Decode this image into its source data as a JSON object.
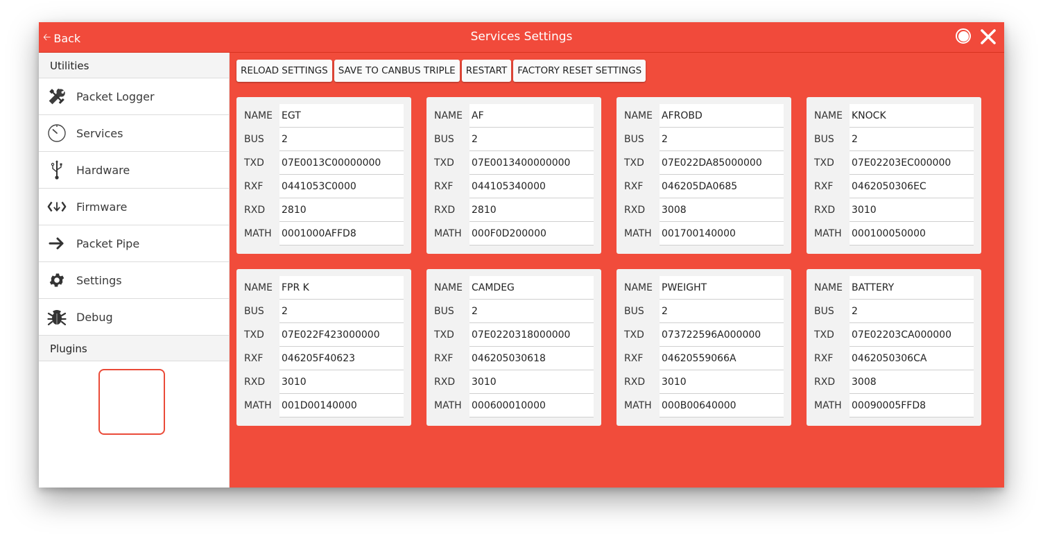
{
  "titlebar": {
    "back_label": "Back",
    "back_icon": "arrow-left-icon",
    "title": "Services Settings",
    "record_icon": "record-icon",
    "close_icon": "close-icon"
  },
  "sidebar": {
    "utilities_header": "Utilities",
    "items": [
      {
        "label": "Packet Logger",
        "icon": "tools-icon"
      },
      {
        "label": "Services",
        "icon": "timer-icon"
      },
      {
        "label": "Hardware",
        "icon": "usb-icon"
      },
      {
        "label": "Firmware",
        "icon": "code-download-icon"
      },
      {
        "label": "Packet Pipe",
        "icon": "arrow-right-icon"
      },
      {
        "label": "Settings",
        "icon": "gear-icon"
      },
      {
        "label": "Debug",
        "icon": "bug-icon"
      }
    ],
    "plugins_header": "Plugins"
  },
  "toolbar": {
    "reload": "RELOAD SETTINGS",
    "save": "SAVE TO CANBUS TRIPLE",
    "restart": "RESTART",
    "factory_reset": "FACTORY RESET SETTINGS"
  },
  "field_labels": {
    "name": "NAME",
    "bus": "BUS",
    "txd": "TXD",
    "rxf": "RXF",
    "rxd": "RXD",
    "math": "MATH"
  },
  "services": [
    {
      "name": "EGT",
      "bus": "2",
      "txd": "07E0013C00000000",
      "rxf": "0441053C0000",
      "rxd": "2810",
      "math": "0001000AFFD8"
    },
    {
      "name": "AF",
      "bus": "2",
      "txd": "07E0013400000000",
      "rxf": "044105340000",
      "rxd": "2810",
      "math": "000F0D200000"
    },
    {
      "name": "AFROBD",
      "bus": "2",
      "txd": "07E022DA85000000",
      "rxf": "046205DA0685",
      "rxd": "3008",
      "math": "001700140000"
    },
    {
      "name": "KNOCK",
      "bus": "2",
      "txd": "07E02203EC000000",
      "rxf": "0462050306EC",
      "rxd": "3010",
      "math": "000100050000"
    },
    {
      "name": "FPR K",
      "bus": "2",
      "txd": "07E022F423000000",
      "rxf": "046205F40623",
      "rxd": "3010",
      "math": "001D00140000"
    },
    {
      "name": "CAMDEG",
      "bus": "2",
      "txd": "07E0220318000000",
      "rxf": "046205030618",
      "rxd": "3010",
      "math": "000600010000"
    },
    {
      "name": "PWEIGHT",
      "bus": "2",
      "txd": "073722596A000000",
      "rxf": "04620559066A",
      "rxd": "3010",
      "math": "000B00640000"
    },
    {
      "name": "BATTERY",
      "bus": "2",
      "txd": "07E02203CA000000",
      "rxf": "0462050306CA",
      "rxd": "3008",
      "math": "00090005FFD8"
    }
  ],
  "colors": {
    "accent": "#f14c3b",
    "card_bg": "#f2f2f2"
  }
}
